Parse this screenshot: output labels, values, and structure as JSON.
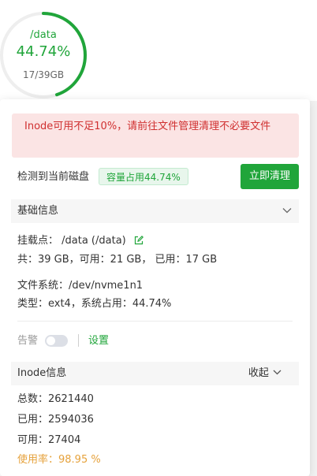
{
  "disk": {
    "path": "/data",
    "percent": "44.74%",
    "percent_value": 44.74,
    "size": "17/39GB"
  },
  "alert": {
    "message": "Inode可用不足10%，请前往文件管理清理不必要文件"
  },
  "detect": {
    "label": "检测到当前磁盘",
    "tag": "容量占用44.74%",
    "clean_button": "立即清理"
  },
  "basic": {
    "header": "基础信息",
    "mount": "挂载点： /data (/data)",
    "capacity": "共：39 GB，可用：21 GB， 已用：17 GB",
    "filesystem": "文件系统：/dev/nvme1n1",
    "type": "类型：ext4，系统占用：44.74%"
  },
  "alarm": {
    "label": "告警",
    "enabled": false,
    "settings": "设置"
  },
  "inode": {
    "header": "Inode信息",
    "collapse": "收起",
    "total": "总数：2621440",
    "used": "已用：2594036",
    "available": "可用：27404",
    "usage": "使用率：98.95 %"
  },
  "colors": {
    "accent": "#20a53a",
    "danger_text": "#d03030",
    "danger_bg": "#fbe4e4",
    "warning": "#e6a23c"
  }
}
